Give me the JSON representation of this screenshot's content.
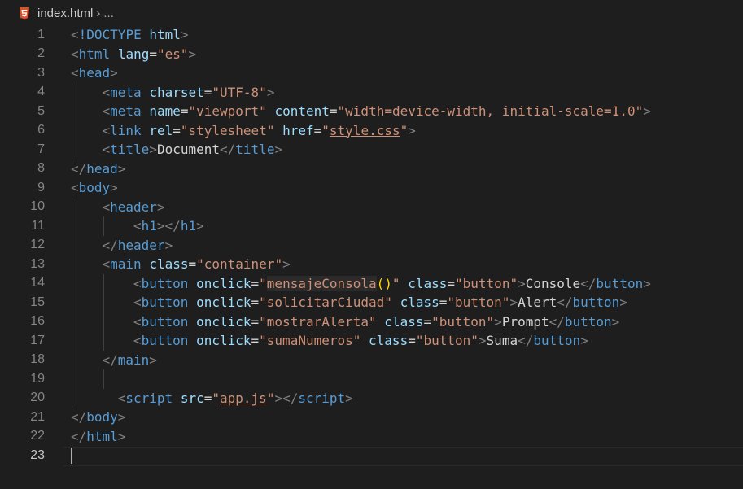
{
  "breadcrumb": {
    "file": "index.html",
    "separator": "›",
    "more": "..."
  },
  "editor": {
    "current_line": 23,
    "lines": [
      {
        "n": "1",
        "indent": 0,
        "tokens": [
          [
            "punct",
            "<"
          ],
          [
            "tag",
            "!DOCTYPE"
          ],
          [
            "text",
            " "
          ],
          [
            "attr",
            "html"
          ],
          [
            "punct",
            ">"
          ]
        ]
      },
      {
        "n": "2",
        "indent": 0,
        "tokens": [
          [
            "punct",
            "<"
          ],
          [
            "tag",
            "html"
          ],
          [
            "text",
            " "
          ],
          [
            "attr",
            "lang"
          ],
          [
            "text",
            "="
          ],
          [
            "str",
            "\"es\""
          ],
          [
            "punct",
            ">"
          ]
        ]
      },
      {
        "n": "3",
        "indent": 0,
        "tokens": [
          [
            "punct",
            "<"
          ],
          [
            "tag",
            "head"
          ],
          [
            "punct",
            ">"
          ]
        ]
      },
      {
        "n": "4",
        "indent": 1,
        "tokens": [
          [
            "punct",
            "<"
          ],
          [
            "tag",
            "meta"
          ],
          [
            "text",
            " "
          ],
          [
            "attr",
            "charset"
          ],
          [
            "text",
            "="
          ],
          [
            "str",
            "\"UTF-8\""
          ],
          [
            "punct",
            ">"
          ]
        ]
      },
      {
        "n": "5",
        "indent": 1,
        "tokens": [
          [
            "punct",
            "<"
          ],
          [
            "tag",
            "meta"
          ],
          [
            "text",
            " "
          ],
          [
            "attr",
            "name"
          ],
          [
            "text",
            "="
          ],
          [
            "str",
            "\"viewport\""
          ],
          [
            "text",
            " "
          ],
          [
            "attr",
            "content"
          ],
          [
            "text",
            "="
          ],
          [
            "str",
            "\"width=device-width, initial-scale=1.0\""
          ],
          [
            "punct",
            ">"
          ]
        ]
      },
      {
        "n": "6",
        "indent": 1,
        "tokens": [
          [
            "punct",
            "<"
          ],
          [
            "tag",
            "link"
          ],
          [
            "text",
            " "
          ],
          [
            "attr",
            "rel"
          ],
          [
            "text",
            "="
          ],
          [
            "str",
            "\"stylesheet\""
          ],
          [
            "text",
            " "
          ],
          [
            "attr",
            "href"
          ],
          [
            "text",
            "="
          ],
          [
            "str",
            "\""
          ],
          [
            "link",
            "style.css"
          ],
          [
            "str",
            "\""
          ],
          [
            "punct",
            ">"
          ]
        ]
      },
      {
        "n": "7",
        "indent": 1,
        "tokens": [
          [
            "punct",
            "<"
          ],
          [
            "tag",
            "title"
          ],
          [
            "punct",
            ">"
          ],
          [
            "text",
            "Document"
          ],
          [
            "punct",
            "</"
          ],
          [
            "tag",
            "title"
          ],
          [
            "punct",
            ">"
          ]
        ]
      },
      {
        "n": "8",
        "indent": 0,
        "tokens": [
          [
            "punct",
            "</"
          ],
          [
            "tag",
            "head"
          ],
          [
            "punct",
            ">"
          ]
        ]
      },
      {
        "n": "9",
        "indent": 0,
        "tokens": [
          [
            "punct",
            "<"
          ],
          [
            "tag",
            "body"
          ],
          [
            "punct",
            ">"
          ]
        ]
      },
      {
        "n": "10",
        "indent": 1,
        "tokens": [
          [
            "punct",
            "<"
          ],
          [
            "tag",
            "header"
          ],
          [
            "punct",
            ">"
          ]
        ]
      },
      {
        "n": "11",
        "indent": 2,
        "tokens": [
          [
            "punct",
            "<"
          ],
          [
            "tag",
            "h1"
          ],
          [
            "punct",
            "></"
          ],
          [
            "tag",
            "h1"
          ],
          [
            "punct",
            ">"
          ]
        ]
      },
      {
        "n": "12",
        "indent": 1,
        "tokens": [
          [
            "punct",
            "</"
          ],
          [
            "tag",
            "header"
          ],
          [
            "punct",
            ">"
          ]
        ]
      },
      {
        "n": "13",
        "indent": 1,
        "tokens": [
          [
            "punct",
            "<"
          ],
          [
            "tag",
            "main"
          ],
          [
            "text",
            " "
          ],
          [
            "attr",
            "class"
          ],
          [
            "text",
            "="
          ],
          [
            "str",
            "\"container\""
          ],
          [
            "punct",
            ">"
          ]
        ]
      },
      {
        "n": "14",
        "indent": 2,
        "tokens": [
          [
            "punct",
            "<"
          ],
          [
            "tag",
            "button"
          ],
          [
            "text",
            " "
          ],
          [
            "attr",
            "onclick"
          ],
          [
            "text",
            "="
          ],
          [
            "str",
            "\""
          ],
          [
            "hl",
            "mensajeConsola"
          ],
          [
            "paren",
            "()"
          ],
          [
            "str",
            "\""
          ],
          [
            "text",
            " "
          ],
          [
            "attr",
            "class"
          ],
          [
            "text",
            "="
          ],
          [
            "str",
            "\"button\""
          ],
          [
            "punct",
            ">"
          ],
          [
            "text",
            "Console"
          ],
          [
            "punct",
            "</"
          ],
          [
            "tag",
            "button"
          ],
          [
            "punct",
            ">"
          ]
        ]
      },
      {
        "n": "15",
        "indent": 2,
        "tokens": [
          [
            "punct",
            "<"
          ],
          [
            "tag",
            "button"
          ],
          [
            "text",
            " "
          ],
          [
            "attr",
            "onclick"
          ],
          [
            "text",
            "="
          ],
          [
            "str",
            "\"solicitarCiudad\""
          ],
          [
            "text",
            " "
          ],
          [
            "attr",
            "class"
          ],
          [
            "text",
            "="
          ],
          [
            "str",
            "\"button\""
          ],
          [
            "punct",
            ">"
          ],
          [
            "text",
            "Alert"
          ],
          [
            "punct",
            "</"
          ],
          [
            "tag",
            "button"
          ],
          [
            "punct",
            ">"
          ]
        ]
      },
      {
        "n": "16",
        "indent": 2,
        "tokens": [
          [
            "punct",
            "<"
          ],
          [
            "tag",
            "button"
          ],
          [
            "text",
            " "
          ],
          [
            "attr",
            "onclick"
          ],
          [
            "text",
            "="
          ],
          [
            "str",
            "\"mostrarAlerta\""
          ],
          [
            "text",
            " "
          ],
          [
            "attr",
            "class"
          ],
          [
            "text",
            "="
          ],
          [
            "str",
            "\"button\""
          ],
          [
            "punct",
            ">"
          ],
          [
            "text",
            "Prompt"
          ],
          [
            "punct",
            "</"
          ],
          [
            "tag",
            "button"
          ],
          [
            "punct",
            ">"
          ]
        ]
      },
      {
        "n": "17",
        "indent": 2,
        "tokens": [
          [
            "punct",
            "<"
          ],
          [
            "tag",
            "button"
          ],
          [
            "text",
            " "
          ],
          [
            "attr",
            "onclick"
          ],
          [
            "text",
            "="
          ],
          [
            "str",
            "\"sumaNumeros\""
          ],
          [
            "text",
            " "
          ],
          [
            "attr",
            "class"
          ],
          [
            "text",
            "="
          ],
          [
            "str",
            "\"button\""
          ],
          [
            "punct",
            ">"
          ],
          [
            "text",
            "Suma"
          ],
          [
            "punct",
            "</"
          ],
          [
            "tag",
            "button"
          ],
          [
            "punct",
            ">"
          ]
        ]
      },
      {
        "n": "18",
        "indent": 1,
        "tokens": [
          [
            "punct",
            "</"
          ],
          [
            "tag",
            "main"
          ],
          [
            "punct",
            ">"
          ]
        ]
      },
      {
        "n": "19",
        "indent": 0,
        "tokens": []
      },
      {
        "n": "20",
        "indent": 1.5,
        "tokens": [
          [
            "punct",
            "<"
          ],
          [
            "tag",
            "script"
          ],
          [
            "text",
            " "
          ],
          [
            "attr",
            "src"
          ],
          [
            "text",
            "="
          ],
          [
            "str",
            "\""
          ],
          [
            "link",
            "app.js"
          ],
          [
            "str",
            "\""
          ],
          [
            "punct",
            "></"
          ],
          [
            "tag",
            "script"
          ],
          [
            "punct",
            ">"
          ]
        ]
      },
      {
        "n": "21",
        "indent": 0,
        "tokens": [
          [
            "punct",
            "</"
          ],
          [
            "tag",
            "body"
          ],
          [
            "punct",
            ">"
          ]
        ]
      },
      {
        "n": "22",
        "indent": 0,
        "tokens": [
          [
            "punct",
            "</"
          ],
          [
            "tag",
            "html"
          ],
          [
            "punct",
            ">"
          ]
        ]
      },
      {
        "n": "23",
        "indent": 0,
        "tokens": []
      }
    ]
  },
  "colors": {
    "background": "#1e1e1e",
    "tag": "#569cd6",
    "attribute": "#9cdcfe",
    "string": "#ce9178",
    "punctuation": "#808080",
    "text": "#d4d4d4",
    "line_number": "#858585",
    "html_icon": "#e44d26"
  }
}
